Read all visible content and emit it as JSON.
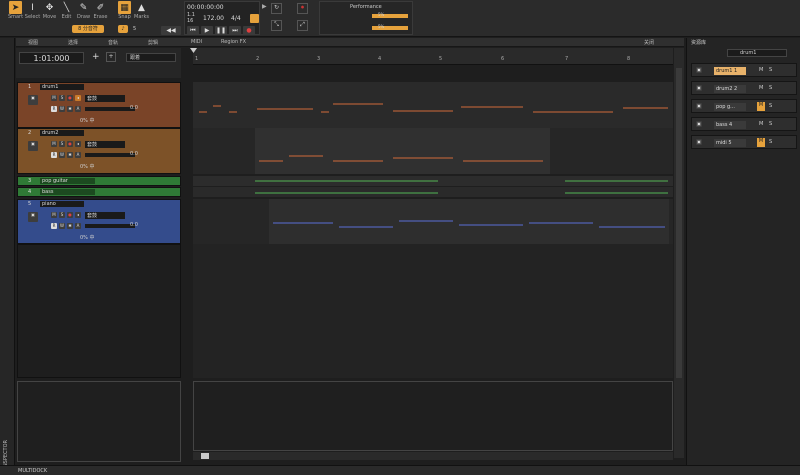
{
  "toolbar": {
    "tools": [
      {
        "label": "Smart",
        "icon": "pointer-icon",
        "glyph": "➤"
      },
      {
        "label": "Select",
        "icon": "ibeam-icon",
        "glyph": "I"
      },
      {
        "label": "Move",
        "icon": "move-icon",
        "glyph": "✥"
      },
      {
        "label": "Edit",
        "icon": "edit-icon",
        "glyph": "╲"
      },
      {
        "label": "Draw",
        "icon": "pencil-icon",
        "glyph": "✎"
      },
      {
        "label": "Erase",
        "icon": "eraser-icon",
        "glyph": "✐"
      }
    ],
    "snap_label": "Snap",
    "marks_label": "Marks",
    "snap_value": "8 分音符",
    "snap_count": "5"
  },
  "transport": {
    "time": "00:00:00:00",
    "position": "1.1",
    "position_b": "16",
    "tempo": "172.00",
    "meter": "4/4"
  },
  "performance": {
    "title": "Performance",
    "val1": "5%",
    "val2": "5%"
  },
  "main_header": {
    "tabs": [
      "视图",
      "选择",
      "音轨",
      "剪辑"
    ],
    "midi_label": "MIDI",
    "region_fx": "Region FX",
    "close_label": "关闭"
  },
  "time_display": "1:01:000",
  "snap_dropdown": "跟着",
  "ruler": {
    "marks": [
      "1",
      "2",
      "3",
      "4",
      "5",
      "6",
      "7",
      "8"
    ]
  },
  "tracks": [
    {
      "num": "1",
      "name": "drum1",
      "channel": "套鼓",
      "value": "0.0",
      "pan": "0% 中",
      "color": "#8f4f2e"
    },
    {
      "num": "2",
      "name": "drum2",
      "channel": "套鼓",
      "value": "0.0",
      "pan": "0% 中",
      "color": "#8a5a2a"
    },
    {
      "num": "3",
      "name": "pop guitar",
      "color": "#2f7a36"
    },
    {
      "num": "4",
      "name": "bass",
      "color": "#2f7a36"
    },
    {
      "num": "5",
      "name": "piano",
      "channel": "套鼓",
      "value": "0.0",
      "pan": "0% 中",
      "color": "#344c8c"
    }
  ],
  "right_panel": {
    "header": "资源库",
    "selected": "drum1",
    "rows": [
      {
        "name": "drum1 1",
        "highlight": true
      },
      {
        "name": "drum2 2",
        "highlight": false
      },
      {
        "name": "pop g...",
        "highlight": false
      },
      {
        "name": "bass 4",
        "highlight": false
      },
      {
        "name": "midi 5",
        "highlight": false
      }
    ],
    "m": "M",
    "s": "S"
  },
  "inspector_label": "INSPECTOR",
  "multidock_label": "MULTIDOCK",
  "colors": {
    "accent": "#e6a23c",
    "drum_notes": "#d06a3a",
    "guitar_notes": "#53b555",
    "piano_notes": "#5b6fd6"
  }
}
